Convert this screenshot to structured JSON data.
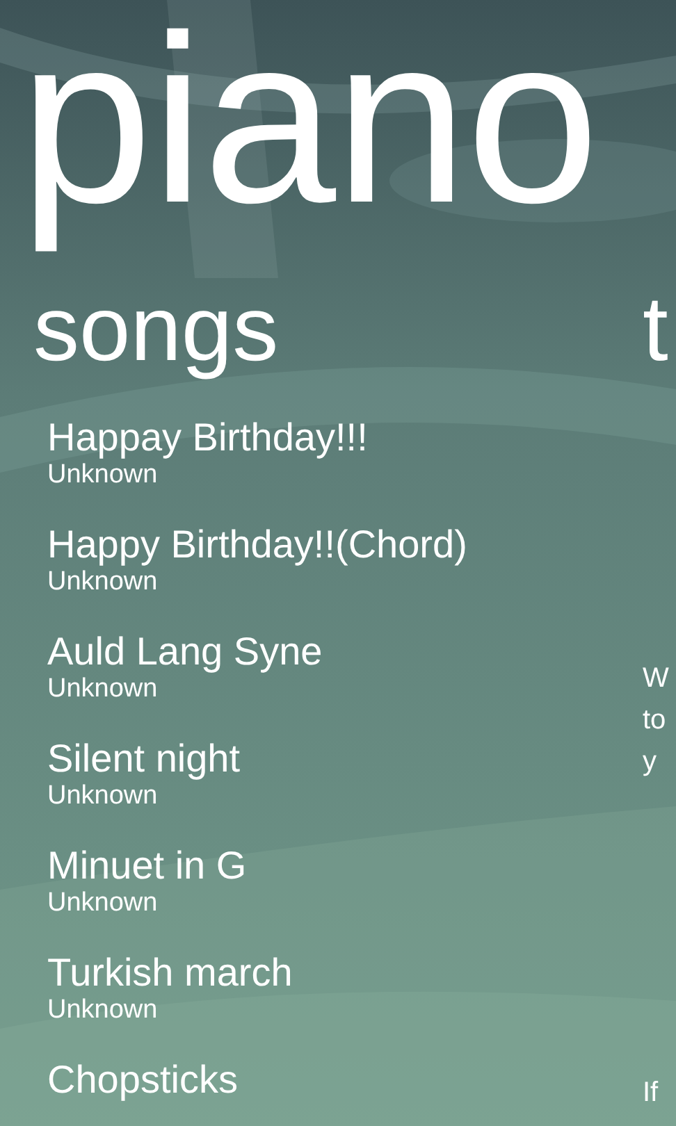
{
  "title": "piano",
  "songs": {
    "header": "songs",
    "items": [
      {
        "title": "Happay Birthday!!!",
        "artist": "Unknown"
      },
      {
        "title": "Happy Birthday!!(Chord)",
        "artist": "Unknown"
      },
      {
        "title": "Auld Lang Syne",
        "artist": "Unknown"
      },
      {
        "title": "Silent night",
        "artist": "Unknown"
      },
      {
        "title": "Minuet in G",
        "artist": "Unknown"
      },
      {
        "title": "Turkish march",
        "artist": "Unknown"
      },
      {
        "title": "Chopsticks"
      }
    ]
  },
  "next_section": {
    "header": "t",
    "paragraph_lines": [
      "W",
      "to",
      "y"
    ],
    "footer": "If"
  }
}
